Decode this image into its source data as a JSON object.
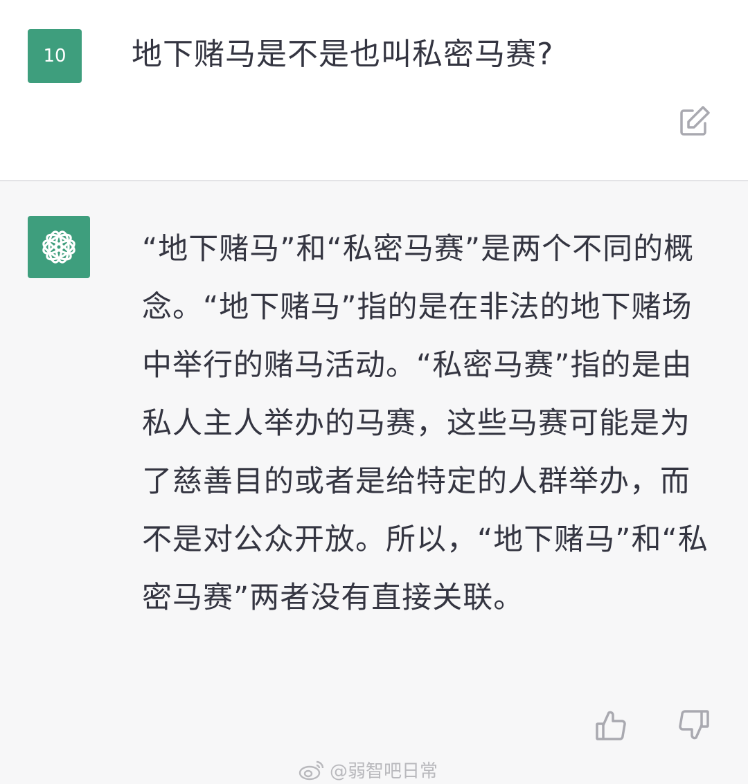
{
  "user": {
    "avatar_text": "10",
    "question": "地下赌马是不是也叫私密马赛?"
  },
  "assistant": {
    "answer": "“地下赌马”和“私密马赛”是两个不同的概念。“地下赌马”指的是在非法的地下赌场中举行的赌马活动。“私密马赛”指的是由私人主人举办的马赛，这些马赛可能是为了慈善目的或者是给特定的人群举办，而不是对公众开放。所以，“地下赌马”和“私密马赛”两者没有直接关联。"
  },
  "watermark": {
    "text": "@弱智吧日常"
  },
  "icons": {
    "edit": "edit-icon",
    "logo": "openai-logo-icon",
    "thumb_up": "thumbs-up-icon",
    "thumb_down": "thumbs-down-icon",
    "weibo": "weibo-icon"
  },
  "colors": {
    "avatar_green": "#3e9e7d",
    "answer_bg": "#f7f7f8",
    "text": "#343541",
    "icon_gray": "#a9a9b0"
  }
}
